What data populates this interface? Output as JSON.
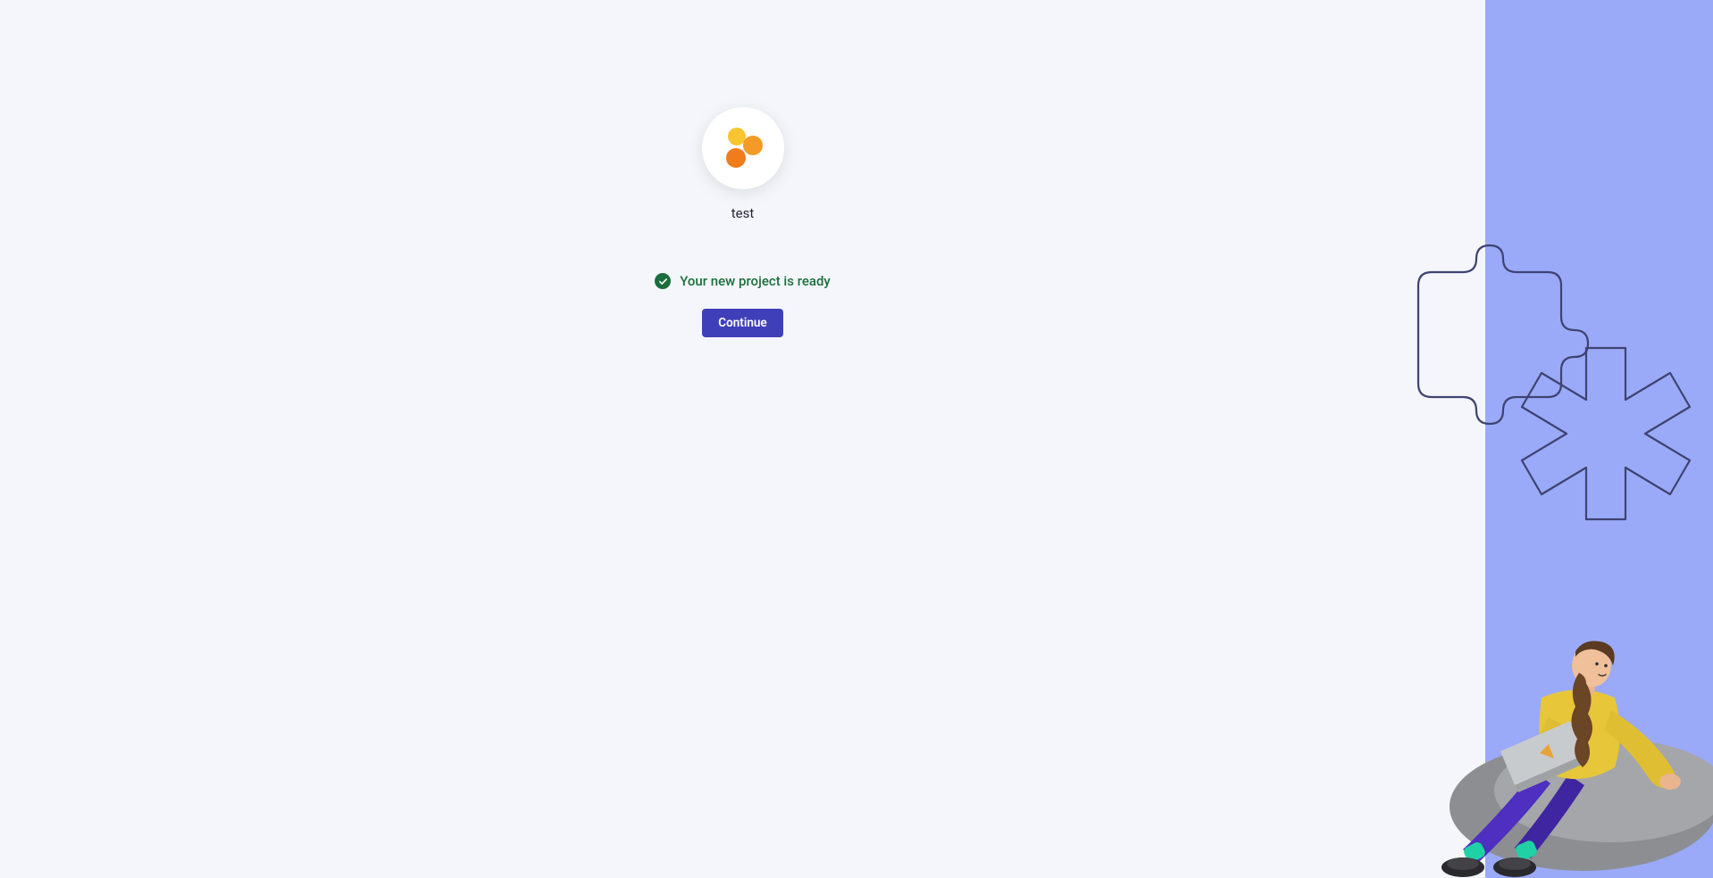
{
  "project": {
    "name": "test"
  },
  "status": {
    "message": "Your new project is ready"
  },
  "actions": {
    "continue_label": "Continue"
  },
  "colors": {
    "brand_purple": "#3f3fb9",
    "success_green": "#1b6e3c",
    "right_panel_blue": "#9aaaf9",
    "page_bg": "#f4f6fb",
    "icon_yellow": "#f8c430",
    "icon_orange_mid": "#f39a27",
    "icon_orange_dark": "#f07c1c"
  }
}
